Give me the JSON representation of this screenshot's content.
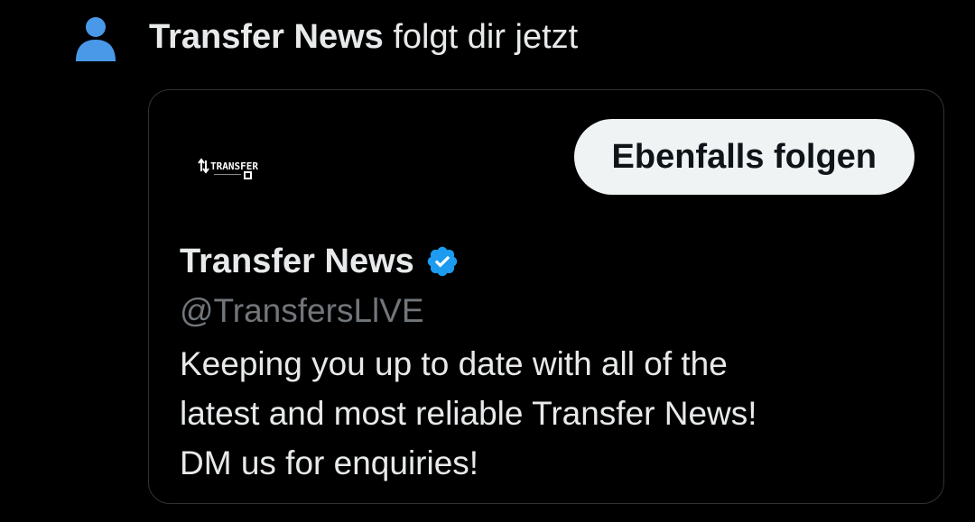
{
  "notification": {
    "icon": "person-icon",
    "icon_color": "#4a99e9",
    "actor_name": "Transfer News",
    "action_text": " folgt dir jetzt"
  },
  "card": {
    "avatar": {
      "icon": "transfer-logo-icon",
      "logo_text": "TRANSFER"
    },
    "follow_button_label": "Ebenfalls folgen",
    "profile_name": "Transfer News",
    "verified_icon": "verified-badge-icon",
    "verified_color": "#1d9bf0",
    "handle": "@TransfersLlVE",
    "bio_lines": [
      "Keeping you up to date with all of the",
      "latest and most reliable Transfer News!",
      "DM us for enquiries!"
    ]
  }
}
